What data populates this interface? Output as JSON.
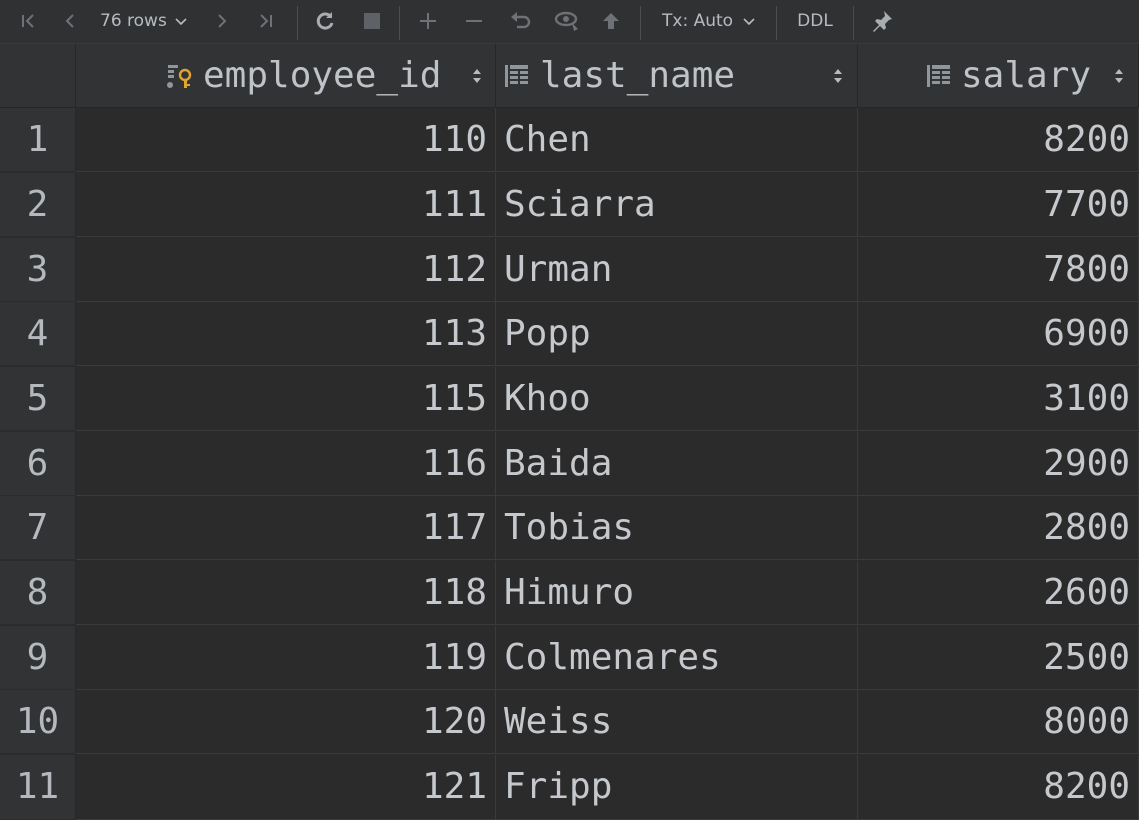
{
  "toolbar": {
    "rows_label": "76 rows",
    "tx_label": "Tx: Auto",
    "ddl_label": "DDL"
  },
  "colors": {
    "background": "#2b2b2b",
    "header_bg": "#313335",
    "text": "#c5c9cd",
    "key_icon": "#e0a432"
  },
  "columns": [
    {
      "name": "employee_id",
      "icon": "primary-key-column-icon",
      "align": "right"
    },
    {
      "name": "last_name",
      "icon": "column-icon",
      "align": "left"
    },
    {
      "name": "salary",
      "icon": "column-icon",
      "align": "right"
    }
  ],
  "rows": [
    {
      "num": "1",
      "employee_id": "110",
      "last_name": "Chen",
      "salary": "8200"
    },
    {
      "num": "2",
      "employee_id": "111",
      "last_name": "Sciarra",
      "salary": "7700"
    },
    {
      "num": "3",
      "employee_id": "112",
      "last_name": "Urman",
      "salary": "7800"
    },
    {
      "num": "4",
      "employee_id": "113",
      "last_name": "Popp",
      "salary": "6900"
    },
    {
      "num": "5",
      "employee_id": "115",
      "last_name": "Khoo",
      "salary": "3100"
    },
    {
      "num": "6",
      "employee_id": "116",
      "last_name": "Baida",
      "salary": "2900"
    },
    {
      "num": "7",
      "employee_id": "117",
      "last_name": "Tobias",
      "salary": "2800"
    },
    {
      "num": "8",
      "employee_id": "118",
      "last_name": "Himuro",
      "salary": "2600"
    },
    {
      "num": "9",
      "employee_id": "119",
      "last_name": "Colmenares",
      "salary": "2500"
    },
    {
      "num": "10",
      "employee_id": "120",
      "last_name": "Weiss",
      "salary": "8000"
    },
    {
      "num": "11",
      "employee_id": "121",
      "last_name": "Fripp",
      "salary": "8200"
    }
  ]
}
